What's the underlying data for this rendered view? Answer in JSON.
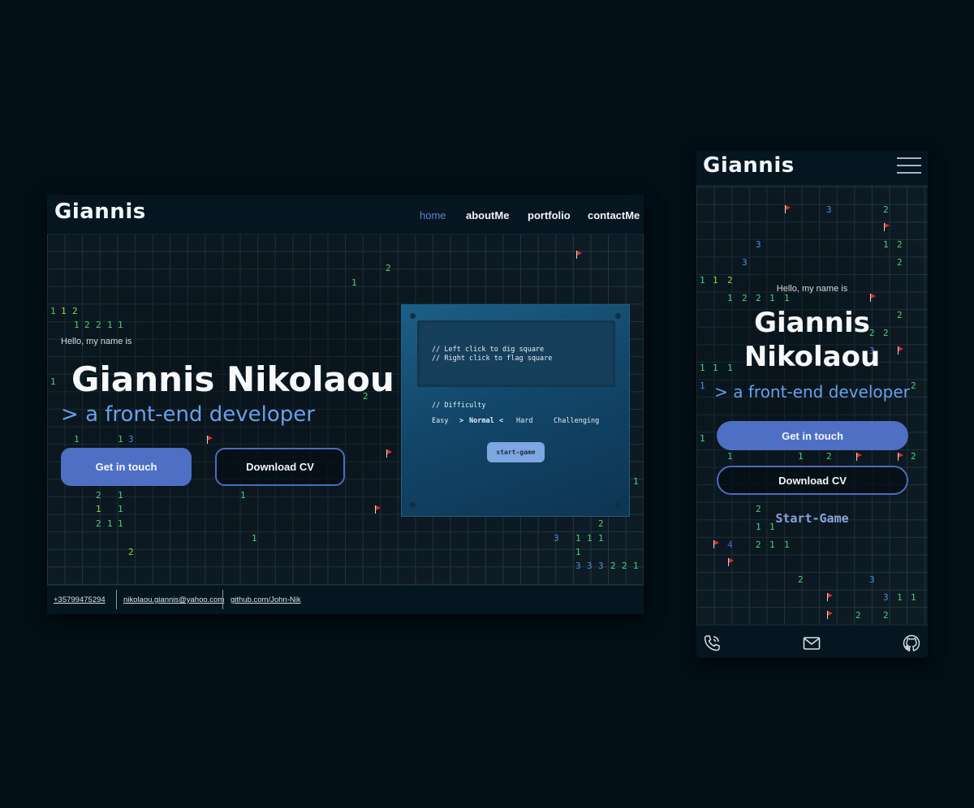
{
  "colors": {
    "page_bg": "#020f17",
    "accent": "#4f6fc4",
    "role_text": "#69a0e8",
    "nav_active": "#5c83d6",
    "flag": "#e52b2b"
  },
  "desktop": {
    "logo": "Giannis",
    "nav": [
      {
        "label": "home",
        "active": true
      },
      {
        "label": "aboutMe",
        "active": false
      },
      {
        "label": "portfolio",
        "active": false
      },
      {
        "label": "contactMe",
        "active": false
      }
    ],
    "hero": {
      "greeting": "Hello, my name is",
      "name": "Giannis Nikolaou",
      "chevron": ">",
      "role": "a front-end developer",
      "primary_button": "Get in touch",
      "secondary_button": "Download CV"
    },
    "game_panel": {
      "instruction_1": "// Left click to dig square",
      "instruction_2": "// Right click to flag square",
      "difficulty_label": "// Difficulty",
      "options": [
        "Easy",
        "Normal",
        "Hard",
        "Challenging"
      ],
      "selected_option": "Normal",
      "selected_prefix": ">",
      "selected_suffix": "<",
      "start_button": "start-game"
    },
    "footer": {
      "phone": "+35799475294",
      "email": "nikolaou.giannis@yahoo.com",
      "github": "github.com/John-Nik"
    }
  },
  "mobile": {
    "logo": "Giannis",
    "hero": {
      "greeting": "Hello, my name is",
      "name_line1": "Giannis",
      "name_line2": "Nikolaou",
      "chevron": ">",
      "role": "a front-end developer",
      "primary_button": "Get in touch",
      "secondary_button": "Download CV",
      "start_game": "Start-Game"
    },
    "footer_icons": [
      "phone-icon",
      "mail-icon",
      "github-icon"
    ]
  }
}
